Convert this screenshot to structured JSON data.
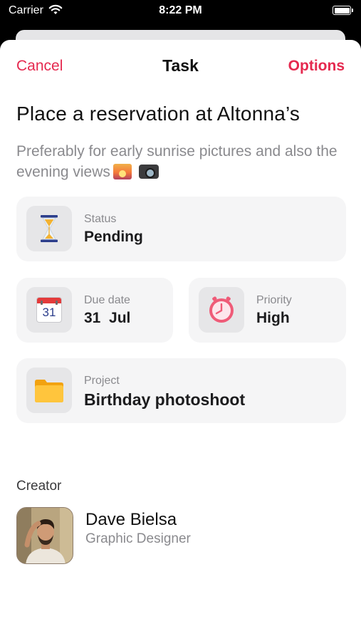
{
  "status_bar": {
    "carrier": "Carrier",
    "time": "8:22 PM"
  },
  "nav": {
    "cancel": "Cancel",
    "title": "Task",
    "options": "Options"
  },
  "accent_color": "#e5294f",
  "task": {
    "title": "Place a reservation at Altonna’s",
    "description": "Preferably for early sunrise pictures and also the evening views"
  },
  "status": {
    "label": "Status",
    "value": "Pending",
    "icon": "hourglass-icon"
  },
  "due_date": {
    "label": "Due date",
    "value": "31  Jul",
    "icon_text": "31",
    "icon": "calendar-icon"
  },
  "priority": {
    "label": "Priority",
    "value": "High",
    "icon": "alarm-clock-icon"
  },
  "project": {
    "label": "Project",
    "value": "Birthday photoshoot",
    "icon": "folder-icon"
  },
  "creator": {
    "section_label": "Creator",
    "name": "Dave Bielsa",
    "role": "Graphic Designer"
  }
}
